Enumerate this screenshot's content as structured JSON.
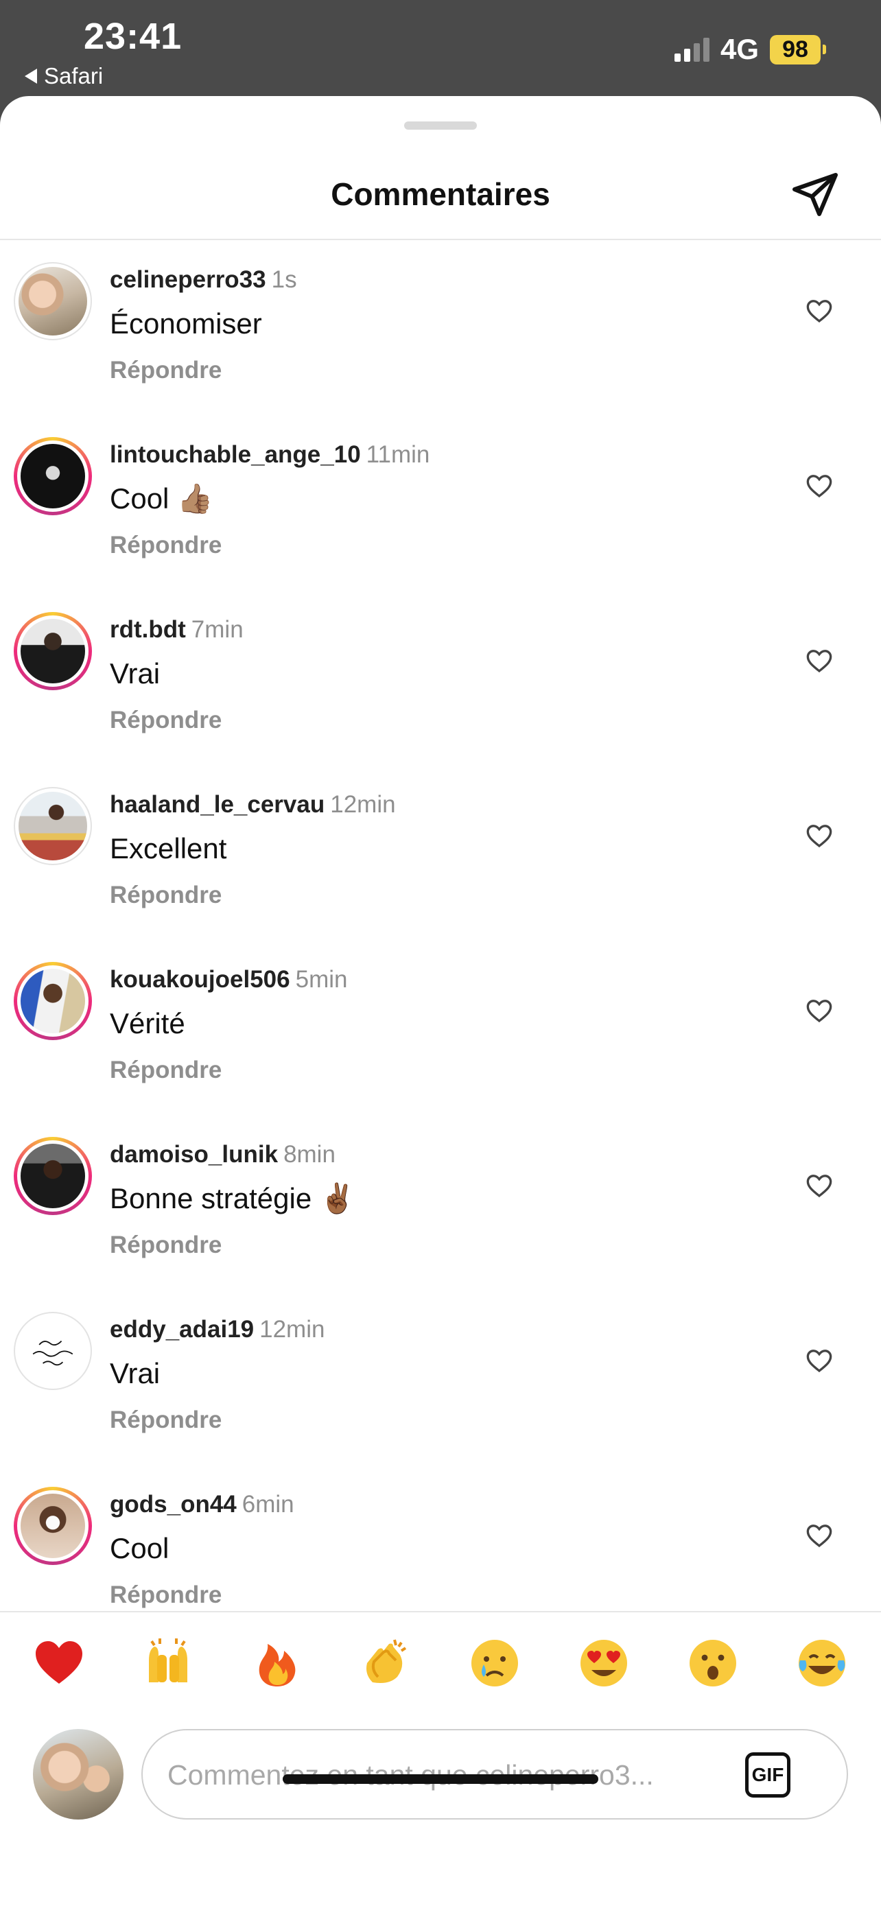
{
  "status_bar": {
    "time": "23:41",
    "back_label": "Safari",
    "network": "4G",
    "battery": "98"
  },
  "sheet": {
    "title": "Commentaires"
  },
  "comments": [
    {
      "user": "celineperro33",
      "time": "1s",
      "text": "Économiser",
      "reply": "Répondre",
      "story_ring": false
    },
    {
      "user": "lintouchable_ange_10",
      "time": "11min",
      "text": "Cool 👍🏽",
      "reply": "Répondre",
      "story_ring": true
    },
    {
      "user": "rdt.bdt",
      "time": "7min",
      "text": "Vrai",
      "reply": "Répondre",
      "story_ring": true
    },
    {
      "user": "haaland_le_cervau",
      "time": "12min",
      "text": "Excellent",
      "reply": "Répondre",
      "story_ring": false
    },
    {
      "user": "kouakoujoel506",
      "time": "5min",
      "text": "Vérité",
      "reply": "Répondre",
      "story_ring": true
    },
    {
      "user": "damoiso_lunik",
      "time": "8min",
      "text": "Bonne stratégie ✌🏾",
      "reply": "Répondre",
      "story_ring": true
    },
    {
      "user": "eddy_adai19",
      "time": "12min",
      "text": "Vrai",
      "reply": "Répondre",
      "story_ring": false
    },
    {
      "user": "gods_on44",
      "time": "6min",
      "text": "Cool",
      "reply": "Répondre",
      "story_ring": true
    }
  ],
  "emoji_bar": [
    "heart-emoji",
    "raising-hands-emoji",
    "fire-emoji",
    "clapping-emoji",
    "crying-emoji",
    "heart-eyes-emoji",
    "surprised-emoji",
    "tears-of-joy-emoji"
  ],
  "input": {
    "placeholder": "Commentez en tant que celineperro3...",
    "gif_label": "GIF"
  },
  "colors": {
    "status_bg": "#4a4a4a",
    "battery": "#f3d34a",
    "muted": "#8e8e8e"
  }
}
